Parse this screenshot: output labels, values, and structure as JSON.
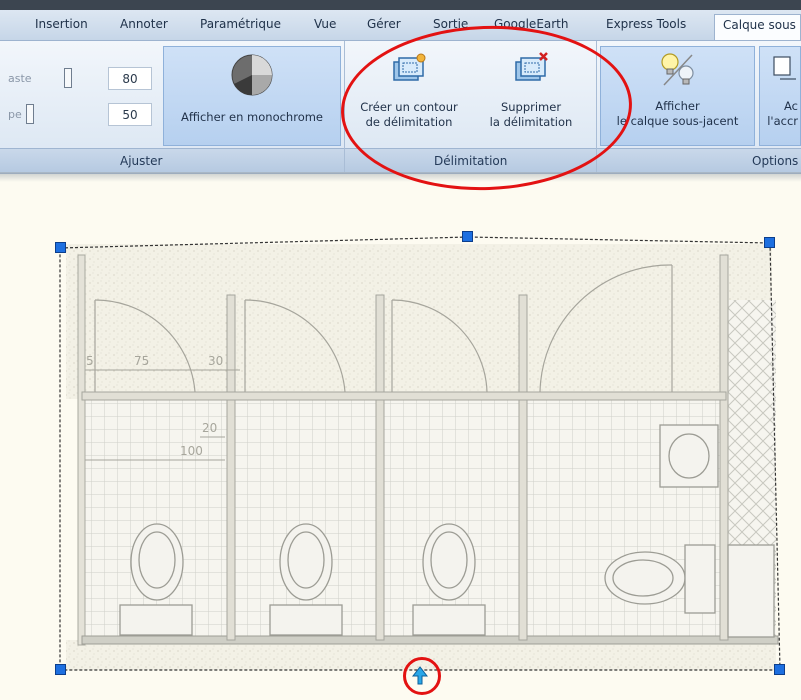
{
  "tabs": [
    "Insertion",
    "Annoter",
    "Paramétrique",
    "Vue",
    "Gérer",
    "Sortie",
    "GoogleEarth",
    "Express Tools",
    "Calque sous"
  ],
  "adjust": {
    "contrast_label": "aste",
    "contrast_value": "80",
    "fade_label": "pe",
    "fade_value": "50",
    "monochrome_button": "Afficher en monochrome",
    "group_label": "Ajuster"
  },
  "clipping": {
    "create_line1": "Créer un contour",
    "create_line2": "de délimitation",
    "delete_line1": "Supprimer",
    "delete_line2": "la délimitation",
    "group_label": "Délimitation"
  },
  "options": {
    "show_line1": "Afficher",
    "show_line2": "le calque sous-jacent",
    "snap_line1": "Ac",
    "snap_line2": "l'accr",
    "group_label": "Options"
  },
  "dimensions": {
    "d5": "5",
    "d75": "75",
    "d30": "30",
    "d20": "20",
    "d100": "100"
  },
  "colors": {
    "annotation_red": "#e31212",
    "grip_blue": "#1d6fe0",
    "ribbon_active": "#b9d2f0"
  }
}
